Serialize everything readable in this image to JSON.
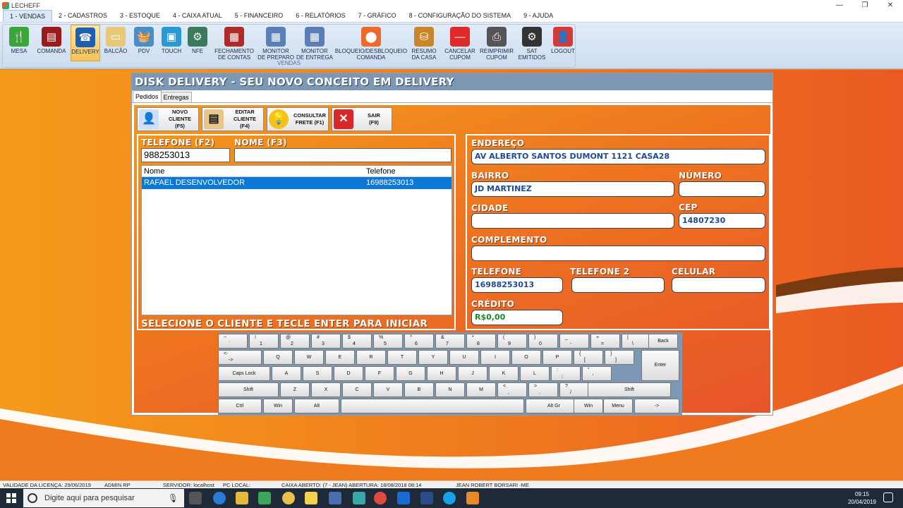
{
  "window": {
    "title": "LECHEFF",
    "minimize": "—",
    "restore": "❐",
    "close": "✕"
  },
  "menu": [
    "1 - VENDAS",
    "2 - CADASTROS",
    "3 - ESTOQUE",
    "4 - CAIXA ATUAL",
    "5 - FINANCEIRO",
    "6 - RELATÓRIOS",
    "7 - GRÁFICO",
    "8 - CONFIGURAÇÃO DO SISTEMA",
    "9 - AJUDA"
  ],
  "ribbon": {
    "group_label": "VENDAS",
    "buttons": [
      {
        "l1": "MESA",
        "l2": "",
        "icon": "fork-knife-icon",
        "color": "#3aa63a",
        "glyph": "🍴"
      },
      {
        "l1": "COMANDA",
        "l2": "",
        "icon": "comanda-icon",
        "color": "#9b1b1b",
        "glyph": "▤"
      },
      {
        "l1": "DELIVERY",
        "l2": "",
        "icon": "phone-icon",
        "color": "#1d5fb0",
        "glyph": "☎"
      },
      {
        "l1": "BALCÃO",
        "l2": "",
        "icon": "folder-icon",
        "color": "#e8c97a",
        "glyph": "▭"
      },
      {
        "l1": "PDV",
        "l2": "",
        "icon": "basket-icon",
        "color": "#4a8ec9",
        "glyph": "🧺"
      },
      {
        "l1": "TOUCH",
        "l2": "",
        "icon": "touch-monitor-icon",
        "color": "#2a9ad6",
        "glyph": "▣"
      },
      {
        "l1": "NFE",
        "l2": "",
        "icon": "gear-nfe-icon",
        "color": "#3b7a5a",
        "glyph": "⚙"
      },
      {
        "l1": "FECHAMENTO",
        "l2": "DE CONTAS",
        "icon": "register-icon",
        "color": "#b02a2a",
        "glyph": "▦"
      },
      {
        "l1": "MONITOR",
        "l2": "DE PREPARO",
        "icon": "monitor-prep-icon",
        "color": "#5a7fb8",
        "glyph": "▦"
      },
      {
        "l1": "MONITOR",
        "l2": "DE ENTREGA",
        "icon": "monitor-delivery-icon",
        "color": "#5a7fb8",
        "glyph": "▦"
      },
      {
        "l1": "BLOQUEIO/DESBLOQUEIO",
        "l2": "COMANDA",
        "icon": "lock-comanda-icon",
        "color": "#ef6a2a",
        "glyph": "⬤"
      },
      {
        "l1": "RESUMO",
        "l2": "DA CASA",
        "icon": "jar-icon",
        "color": "#c9852a",
        "glyph": "⛁"
      },
      {
        "l1": "CANCELAR",
        "l2": "CUPOM",
        "icon": "cancel-icon",
        "color": "#e02a2a",
        "glyph": "—"
      },
      {
        "l1": "REIMPRIMIR",
        "l2": "CUPOM",
        "icon": "printer-icon",
        "color": "#555",
        "glyph": "⎙"
      },
      {
        "l1": "SAT",
        "l2": "EMITIDOS",
        "icon": "sat-icon",
        "color": "#333",
        "glyph": "⚙"
      },
      {
        "l1": "LOGOUT",
        "l2": "",
        "icon": "user-logout-icon",
        "color": "#d33a3a",
        "glyph": "👤"
      }
    ]
  },
  "delivery": {
    "title": "DISK DELIVERY - SEU NOVO CONCEITO EM DELIVERY",
    "tabs": [
      "Pedidos",
      "Entregas"
    ],
    "actions": [
      {
        "l1": "NOVO CLIENTE",
        "l2": "(F5)"
      },
      {
        "l1": "EDITAR CLIENTE",
        "l2": "(F4)"
      },
      {
        "l1": "CONSULTAR",
        "l2": "FRETE (F1)"
      },
      {
        "l1": "SAIR",
        "l2": "(F9)"
      }
    ],
    "search": {
      "phone_label": "TELEFONE (F2)",
      "name_label": "NOME (F3)",
      "phone_value": "988253013",
      "name_value": ""
    },
    "grid": {
      "columns": [
        "Nome",
        "Telefone"
      ],
      "rows": [
        {
          "nome": "RAFAEL DESENVOLVEDOR",
          "telefone": "16988253013"
        }
      ]
    },
    "hint": "SELECIONE O CLIENTE E TECLE ENTER PARA INICIAR",
    "customer": {
      "endereco_label": "ENDEREÇO",
      "endereco": "AV ALBERTO SANTOS DUMONT 1121 CASA28",
      "bairro_label": "BAIRRO",
      "bairro": "JD MARTINEZ",
      "numero_label": "NÚMERO",
      "numero": "",
      "cidade_label": "CIDADE",
      "cidade": "",
      "cep_label": "CEP",
      "cep": "14807230",
      "complemento_label": "COMPLEMENTO",
      "complemento": "",
      "telefone_label": "TELEFONE",
      "telefone": "16988253013",
      "telefone2_label": "TELEFONE 2",
      "telefone2": "",
      "celular_label": "CELULAR",
      "celular": "",
      "credito_label": "CRÉDITO",
      "credito": "R$0,00"
    }
  },
  "keyboard": {
    "rows": [
      [
        [
          "~",
          "`"
        ],
        [
          "!",
          "1"
        ],
        [
          "@",
          "2"
        ],
        [
          "#",
          "3"
        ],
        [
          "$",
          "4"
        ],
        [
          "%",
          "5"
        ],
        [
          "^",
          "6"
        ],
        [
          "&",
          "7"
        ],
        [
          "*",
          "8"
        ],
        [
          "(",
          "9"
        ],
        [
          ")",
          "0"
        ],
        [
          "_",
          "-"
        ],
        [
          "+",
          "="
        ],
        [
          "|",
          "\\"
        ],
        [
          "",
          "Back"
        ]
      ],
      [
        [
          "<-",
          "->"
        ],
        [
          "",
          "Q"
        ],
        [
          "",
          "W"
        ],
        [
          "",
          "E"
        ],
        [
          "",
          "R"
        ],
        [
          "",
          "T"
        ],
        [
          "",
          "Y"
        ],
        [
          "",
          "U"
        ],
        [
          "",
          "I"
        ],
        [
          "",
          "O"
        ],
        [
          "",
          "P"
        ],
        [
          "{",
          "["
        ],
        [
          "}",
          "]"
        ],
        [
          "",
          "Enter"
        ]
      ],
      [
        [
          "",
          "Caps Lock"
        ],
        [
          "",
          "A"
        ],
        [
          "",
          "S"
        ],
        [
          "",
          "D"
        ],
        [
          "",
          "F"
        ],
        [
          "",
          "G"
        ],
        [
          "",
          "H"
        ],
        [
          "",
          "J"
        ],
        [
          "",
          "K"
        ],
        [
          "",
          "L"
        ],
        [
          ":",
          ";"
        ],
        [
          "\"",
          "'"
        ]
      ],
      [
        [
          "",
          "Shift"
        ],
        [
          "",
          "Z"
        ],
        [
          "",
          "X"
        ],
        [
          "",
          "C"
        ],
        [
          "",
          "V"
        ],
        [
          "",
          "B"
        ],
        [
          "",
          "N"
        ],
        [
          "",
          "M"
        ],
        [
          "<",
          ","
        ],
        [
          ">",
          "."
        ],
        [
          "?",
          "/"
        ],
        [
          "",
          "Shift"
        ]
      ],
      [
        [
          "",
          "Ctrl"
        ],
        [
          "",
          "Win"
        ],
        [
          "",
          "Alt"
        ],
        [
          "",
          ""
        ],
        [
          "",
          "Alt Gr"
        ],
        [
          "",
          "Win"
        ],
        [
          "",
          "Menu"
        ],
        [
          "",
          "->"
        ]
      ]
    ]
  },
  "status": {
    "license": "VALIDADE DA LICENÇA: 29/06/2019",
    "user": "ADMIN RP",
    "server": "SERVIDOR: localhost",
    "pc": "PC LOCAL:",
    "caixa": "CAIXA ABERTO: (7 - JEAN) ABERTURA: 18/08/2018 08:14",
    "company": "JEAN ROBERT BORSARI -ME"
  },
  "taskbar": {
    "search_placeholder": "Digite aqui para pesquisar",
    "time": "09:15",
    "date": "20/04/2019"
  }
}
